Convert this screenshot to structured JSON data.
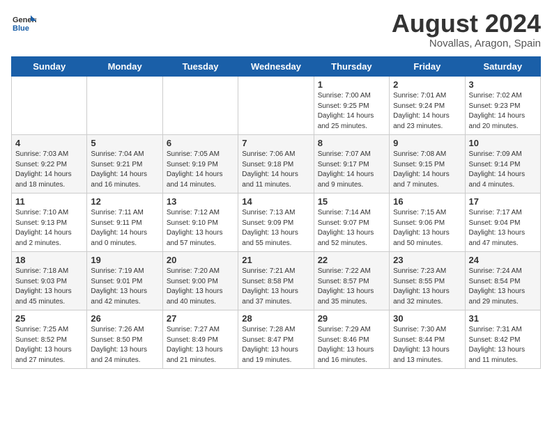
{
  "header": {
    "logo_general": "General",
    "logo_blue": "Blue",
    "month_year": "August 2024",
    "location": "Novallas, Aragon, Spain"
  },
  "days_of_week": [
    "Sunday",
    "Monday",
    "Tuesday",
    "Wednesday",
    "Thursday",
    "Friday",
    "Saturday"
  ],
  "weeks": [
    [
      {
        "day": "",
        "info": ""
      },
      {
        "day": "",
        "info": ""
      },
      {
        "day": "",
        "info": ""
      },
      {
        "day": "",
        "info": ""
      },
      {
        "day": "1",
        "info": "Sunrise: 7:00 AM\nSunset: 9:25 PM\nDaylight: 14 hours and 25 minutes."
      },
      {
        "day": "2",
        "info": "Sunrise: 7:01 AM\nSunset: 9:24 PM\nDaylight: 14 hours and 23 minutes."
      },
      {
        "day": "3",
        "info": "Sunrise: 7:02 AM\nSunset: 9:23 PM\nDaylight: 14 hours and 20 minutes."
      }
    ],
    [
      {
        "day": "4",
        "info": "Sunrise: 7:03 AM\nSunset: 9:22 PM\nDaylight: 14 hours and 18 minutes."
      },
      {
        "day": "5",
        "info": "Sunrise: 7:04 AM\nSunset: 9:21 PM\nDaylight: 14 hours and 16 minutes."
      },
      {
        "day": "6",
        "info": "Sunrise: 7:05 AM\nSunset: 9:19 PM\nDaylight: 14 hours and 14 minutes."
      },
      {
        "day": "7",
        "info": "Sunrise: 7:06 AM\nSunset: 9:18 PM\nDaylight: 14 hours and 11 minutes."
      },
      {
        "day": "8",
        "info": "Sunrise: 7:07 AM\nSunset: 9:17 PM\nDaylight: 14 hours and 9 minutes."
      },
      {
        "day": "9",
        "info": "Sunrise: 7:08 AM\nSunset: 9:15 PM\nDaylight: 14 hours and 7 minutes."
      },
      {
        "day": "10",
        "info": "Sunrise: 7:09 AM\nSunset: 9:14 PM\nDaylight: 14 hours and 4 minutes."
      }
    ],
    [
      {
        "day": "11",
        "info": "Sunrise: 7:10 AM\nSunset: 9:13 PM\nDaylight: 14 hours and 2 minutes."
      },
      {
        "day": "12",
        "info": "Sunrise: 7:11 AM\nSunset: 9:11 PM\nDaylight: 14 hours and 0 minutes."
      },
      {
        "day": "13",
        "info": "Sunrise: 7:12 AM\nSunset: 9:10 PM\nDaylight: 13 hours and 57 minutes."
      },
      {
        "day": "14",
        "info": "Sunrise: 7:13 AM\nSunset: 9:09 PM\nDaylight: 13 hours and 55 minutes."
      },
      {
        "day": "15",
        "info": "Sunrise: 7:14 AM\nSunset: 9:07 PM\nDaylight: 13 hours and 52 minutes."
      },
      {
        "day": "16",
        "info": "Sunrise: 7:15 AM\nSunset: 9:06 PM\nDaylight: 13 hours and 50 minutes."
      },
      {
        "day": "17",
        "info": "Sunrise: 7:17 AM\nSunset: 9:04 PM\nDaylight: 13 hours and 47 minutes."
      }
    ],
    [
      {
        "day": "18",
        "info": "Sunrise: 7:18 AM\nSunset: 9:03 PM\nDaylight: 13 hours and 45 minutes."
      },
      {
        "day": "19",
        "info": "Sunrise: 7:19 AM\nSunset: 9:01 PM\nDaylight: 13 hours and 42 minutes."
      },
      {
        "day": "20",
        "info": "Sunrise: 7:20 AM\nSunset: 9:00 PM\nDaylight: 13 hours and 40 minutes."
      },
      {
        "day": "21",
        "info": "Sunrise: 7:21 AM\nSunset: 8:58 PM\nDaylight: 13 hours and 37 minutes."
      },
      {
        "day": "22",
        "info": "Sunrise: 7:22 AM\nSunset: 8:57 PM\nDaylight: 13 hours and 35 minutes."
      },
      {
        "day": "23",
        "info": "Sunrise: 7:23 AM\nSunset: 8:55 PM\nDaylight: 13 hours and 32 minutes."
      },
      {
        "day": "24",
        "info": "Sunrise: 7:24 AM\nSunset: 8:54 PM\nDaylight: 13 hours and 29 minutes."
      }
    ],
    [
      {
        "day": "25",
        "info": "Sunrise: 7:25 AM\nSunset: 8:52 PM\nDaylight: 13 hours and 27 minutes."
      },
      {
        "day": "26",
        "info": "Sunrise: 7:26 AM\nSunset: 8:50 PM\nDaylight: 13 hours and 24 minutes."
      },
      {
        "day": "27",
        "info": "Sunrise: 7:27 AM\nSunset: 8:49 PM\nDaylight: 13 hours and 21 minutes."
      },
      {
        "day": "28",
        "info": "Sunrise: 7:28 AM\nSunset: 8:47 PM\nDaylight: 13 hours and 19 minutes."
      },
      {
        "day": "29",
        "info": "Sunrise: 7:29 AM\nSunset: 8:46 PM\nDaylight: 13 hours and 16 minutes."
      },
      {
        "day": "30",
        "info": "Sunrise: 7:30 AM\nSunset: 8:44 PM\nDaylight: 13 hours and 13 minutes."
      },
      {
        "day": "31",
        "info": "Sunrise: 7:31 AM\nSunset: 8:42 PM\nDaylight: 13 hours and 11 minutes."
      }
    ]
  ]
}
